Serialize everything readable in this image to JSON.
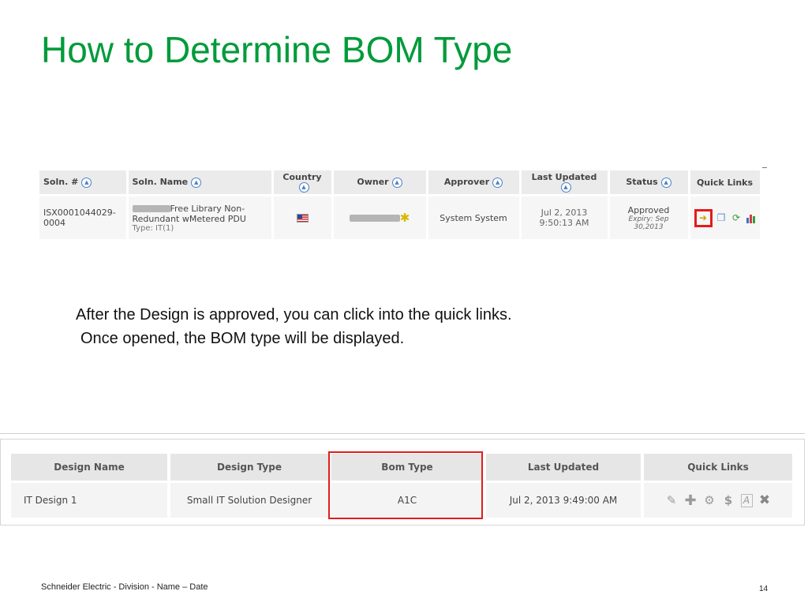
{
  "slide": {
    "title": "How to Determine BOM Type",
    "footer": "Schneider Electric - Division - Name – Date",
    "page_number": "14"
  },
  "solutions_table": {
    "headers": [
      "Soln. #",
      "Soln. Name",
      "Country",
      "Owner",
      "Approver",
      "Last Updated",
      "Status",
      "Quick Links"
    ],
    "row": {
      "soln_number": "ISX0001044029-0004",
      "soln_name_line1": "Free Library Non-",
      "soln_name_line2": "Redundant wMetered PDU",
      "soln_type": "Type: IT(1)",
      "country_icon": "us-flag-icon",
      "owner_icon": "star-icon",
      "approver": "System System",
      "last_updated": "Jul 2, 2013 9:50:13 AM",
      "status": "Approved",
      "expiry": "Expiry: Sep 30,2013"
    },
    "quick_link_icons": [
      "open-arrow-icon",
      "copy-icon",
      "refresh-icon",
      "chart-icon"
    ]
  },
  "instructions": {
    "line1": "After the Design is approved, you can click into the quick links.",
    "line2": "Once opened, the BOM type will be displayed."
  },
  "design_table": {
    "headers": [
      "Design Name",
      "Design Type",
      "Bom Type",
      "Last Updated",
      "Quick Links"
    ],
    "row": {
      "design_name": "IT Design 1",
      "design_type": "Small IT Solution Designer",
      "bom_type": "A1C",
      "last_updated": "Jul 2, 2013 9:49:00 AM"
    },
    "quick_link_icons": [
      "edit-icon",
      "add-icon",
      "gear-icon",
      "dollar-icon",
      "font-icon",
      "close-icon"
    ]
  },
  "colors": {
    "title": "#009b3a",
    "highlight": "#e51b1b",
    "sort_icon": "#4c80c8"
  }
}
